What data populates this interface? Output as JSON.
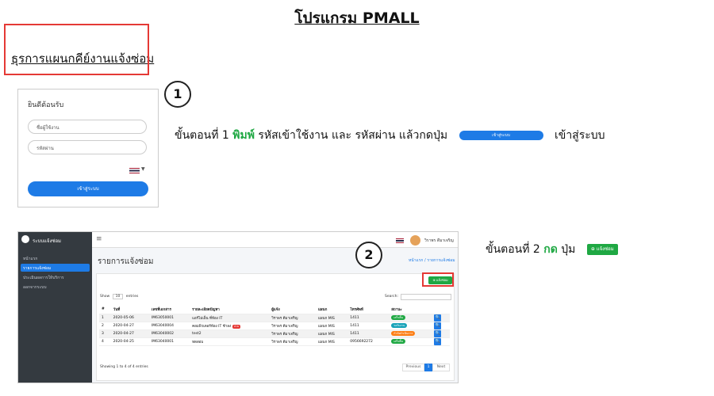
{
  "title": "โปรแกรม PMALL",
  "subtitle": "ธุรการแผนกคีย์งานแจ้งซ่อม",
  "login": {
    "welcome": "ยินดีต้อนรับ",
    "username_placeholder": "ชื่อผู้ใช้งาน",
    "password_placeholder": "รหัสผ่าน",
    "login_button": "เข้าสู่ระบบ"
  },
  "step1": {
    "number": "1",
    "prefix": "ขั้นตอนที่ 1",
    "action": "พิมพ์",
    "middle": "รหัสเข้าใช้งาน และ รหัสผ่าน แล้วกดปุ่ม",
    "button_label": "เข้าสู่ระบบ",
    "suffix": "เข้าสู่ระบบ"
  },
  "step2": {
    "number": "2",
    "prefix": "ขั้นตอนที่ 2",
    "action": "กด",
    "middle": "ปุ่ม",
    "button_label": "แจ้งซ่อม"
  },
  "app": {
    "brand": "ระบบแจ้งซ่อม",
    "sidebar": [
      "หน้าแรก",
      "รายการแจ้งซ่อม",
      "ประเมินผลการให้บริการ",
      "ออกจากระบบ"
    ],
    "user_name": "วิราพร ดีมาเจริญ",
    "page_title": "รายการแจ้งซ่อม",
    "breadcrumb": "หน้าแรก / รายการแจ้งซ่อม",
    "add_button": "แจ้งซ่อม",
    "show_label": "Show",
    "show_value": "10",
    "entries_label": "entries",
    "search_label": "Search:",
    "columns": [
      "#",
      "วันที่",
      "เลขที่เอกสาร",
      "รายละเอียดปัญหา",
      "ผู้แจ้ง",
      "แผนก",
      "โทรศัพท์",
      "สถานะ",
      ""
    ],
    "rows": [
      [
        "1",
        "2020-05-06",
        "IM63050001",
        "แอร์ไม่เย็น ที่ห้อง IT",
        "",
        "วิราพร ดีมาเจริญ",
        "แผนก MIS",
        "1411",
        "เสร็จสิ้น"
      ],
      [
        "2",
        "2020-04-27",
        "IM63040004",
        "คอมพิวเตอร์ห้อง IT ช้าลง",
        "ด่วน",
        "วิราพร ดีมาเจริญ",
        "แผนก MIS",
        "1411",
        "รอรับงาน"
      ],
      [
        "3",
        "2020-04-27",
        "IM63040002",
        "test2",
        "",
        "วิราพร ดีมาเจริญ",
        "แผนก MIS",
        "1411",
        "กำลังดำเนินการ"
      ],
      [
        "4",
        "2020-04-25",
        "IM63040001",
        "ทดสอบ",
        "",
        "วิราพร ดีมาเจริญ",
        "แผนก MIS",
        "0956692272",
        "เสร็จสิ้น"
      ]
    ],
    "status_colors": {
      "เสร็จสิ้น": "#1fa843",
      "รอรับงาน": "#17a2b8",
      "กำลังดำเนินการ": "#fd7e14"
    },
    "footer_info": "Showing 1 to 4 of 4 entries",
    "pagination": {
      "previous": "Previous",
      "current": "1",
      "next": "Next"
    }
  }
}
